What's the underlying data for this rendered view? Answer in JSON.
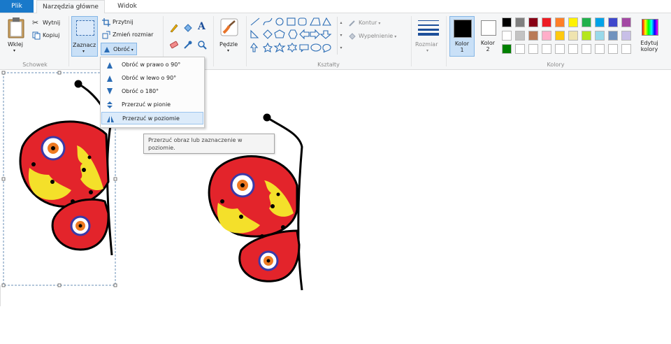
{
  "tabs": {
    "file": "Plik",
    "home": "Narzędzia główne",
    "view": "Widok"
  },
  "clipboard": {
    "paste": "Wklej",
    "cut": "Wytnij",
    "copy": "Kopiuj",
    "group": "Schowek"
  },
  "image": {
    "select": "Zaznacz",
    "crop": "Przytnij",
    "resize": "Zmień rozmiar",
    "rotate": "Obróć"
  },
  "tools": {
    "brushes": "Pędzle"
  },
  "shapes": {
    "outline": "Kontur",
    "fill": "Wypełnienie",
    "group": "Kształty"
  },
  "size": {
    "label": "Rozmiar"
  },
  "colors": {
    "color1_line1": "Kolor",
    "color1_line2": "1",
    "color2_line1": "Kolor",
    "color2_line2": "2",
    "edit_line1": "Edytuj",
    "edit_line2": "kolory",
    "group": "Kolory",
    "row1": [
      "#000000",
      "#7f7f7f",
      "#880015",
      "#ed1c24",
      "#ff7f27",
      "#fff200",
      "#22b14c",
      "#00a2e8",
      "#3f48cc",
      "#a349a4"
    ],
    "row2": [
      "#ffffff",
      "#c3c3c3",
      "#b97a57",
      "#ffaec9",
      "#ffc90e",
      "#efe4b0",
      "#b5e61d",
      "#99d9ea",
      "#7092be",
      "#c8bfe7"
    ],
    "row3": [
      "#008000",
      "#ffffff",
      "#ffffff",
      "#ffffff",
      "#ffffff",
      "#ffffff",
      "#ffffff",
      "#ffffff",
      "#ffffff",
      "#ffffff"
    ]
  },
  "rotate_menu": {
    "items": [
      "Obróć w prawo o 90°",
      "Obróć w lewo o 90°",
      "Obróć o 180°",
      "Przerzuć w pionie",
      "Przerzuć w poziomie"
    ]
  },
  "tooltip": {
    "line1": "Przerzuć obraz lub zaznaczenie w",
    "line2": "poziomie."
  },
  "accent": "#1979ca"
}
